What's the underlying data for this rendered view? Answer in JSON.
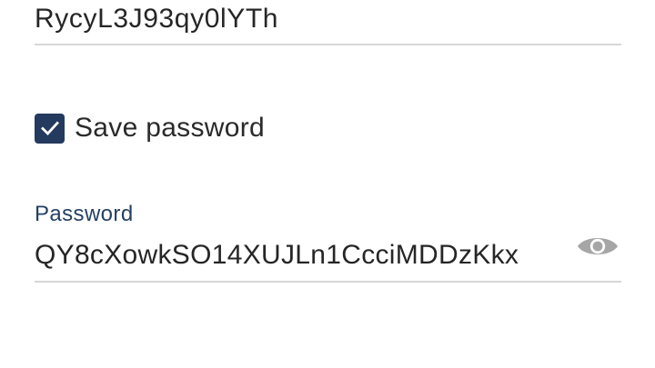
{
  "username_field": {
    "value": "RycyL3J93qy0lYTh"
  },
  "save_password": {
    "label": "Save password",
    "checked": true
  },
  "password_field": {
    "label": "Password",
    "value": "QY8cXowkSO14XUJLn1CcciMDDzKkx",
    "visibility_icon": "eye-icon"
  },
  "colors": {
    "accent": "#243a5e",
    "label": "#264164",
    "icon": "#a6a6a6",
    "underline": "#d6d6d6"
  }
}
